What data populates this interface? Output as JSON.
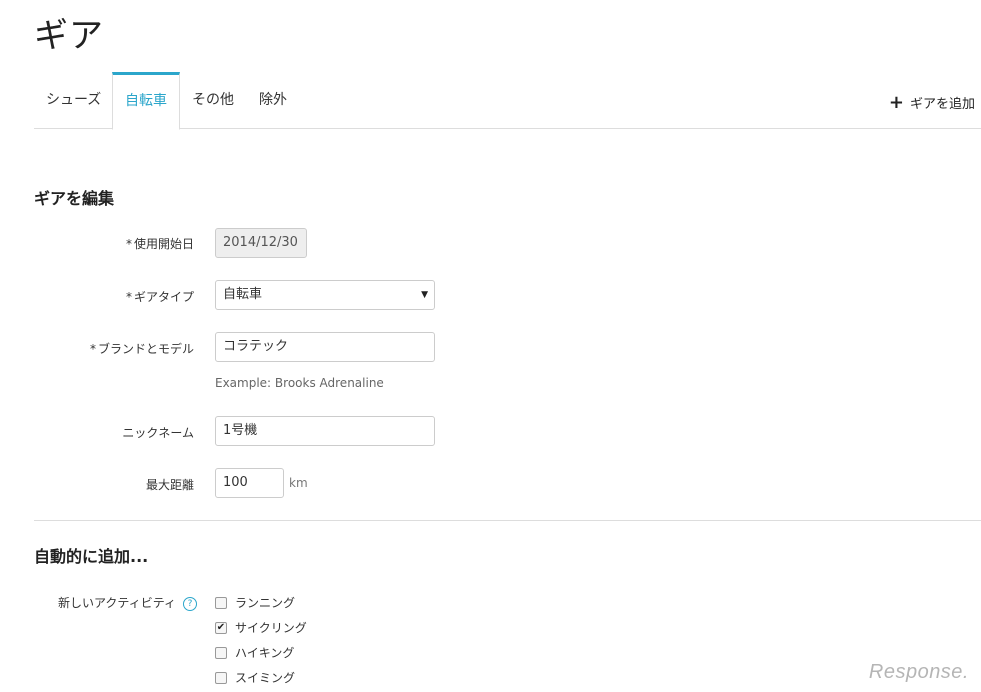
{
  "page": {
    "title": "ギア"
  },
  "tabs": [
    {
      "label": "シューズ",
      "active": false
    },
    {
      "label": "自転車",
      "active": true
    },
    {
      "label": "その他",
      "active": false
    },
    {
      "label": "除外",
      "active": false
    }
  ],
  "add_gear": {
    "icon": "plus-icon",
    "label": "ギアを追加"
  },
  "edit": {
    "title": "ギアを編集",
    "start_date": {
      "label": "使用開始日",
      "required": true,
      "value": "2014/12/30"
    },
    "gear_type": {
      "label": "ギアタイプ",
      "required": true,
      "value": "自転車"
    },
    "brand_model": {
      "label": "ブランドとモデル",
      "required": true,
      "value": "コラテック",
      "help": "Example: Brooks Adrenaline"
    },
    "nickname": {
      "label": "ニックネーム",
      "value": "1号機"
    },
    "max_distance": {
      "label": "最大距離",
      "value": "100",
      "unit": "km"
    }
  },
  "auto_add": {
    "title": "自動的に追加...",
    "new_activity_label": "新しいアクティビティ",
    "info_icon": "question-icon",
    "options": [
      {
        "label": "ランニング",
        "checked": false
      },
      {
        "label": "サイクリング",
        "checked": true
      },
      {
        "label": "ハイキング",
        "checked": false
      },
      {
        "label": "スイミング",
        "checked": false
      }
    ]
  },
  "required_mark": "*",
  "watermark": "Response.",
  "colors": {
    "accent": "#2ba6cb",
    "border": "#dddddd"
  }
}
